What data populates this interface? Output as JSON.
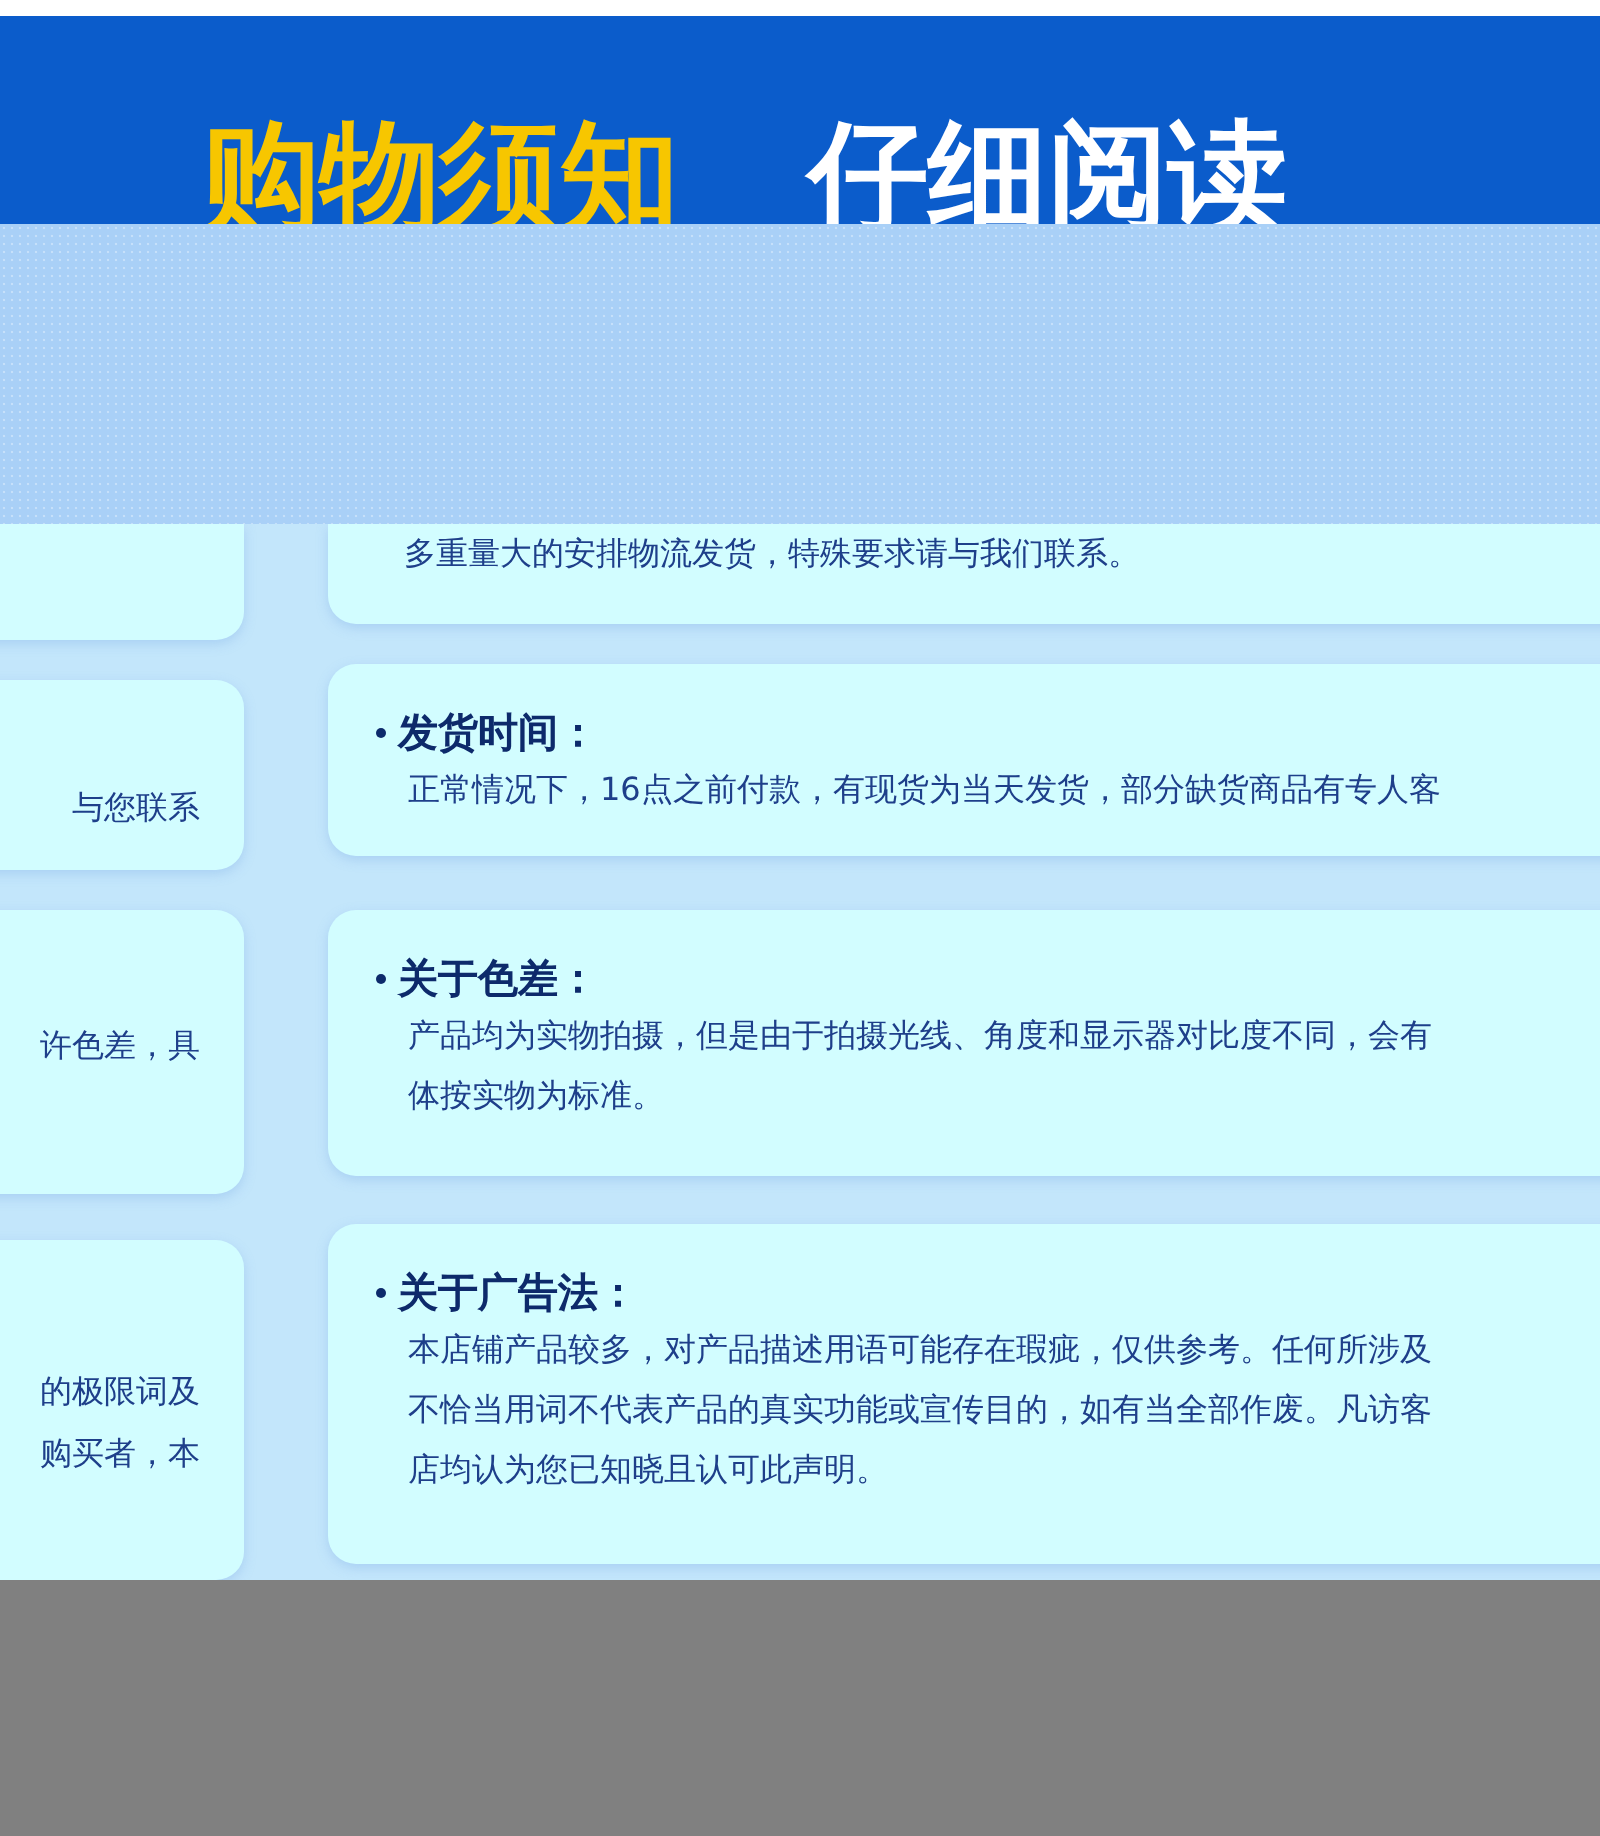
{
  "header": {
    "title_highlight": "购物须知",
    "title_rest": "仔细阅读"
  },
  "left_cards": [
    {
      "lines": [
        "与您联系"
      ]
    },
    {
      "lines": [
        "许色差，具"
      ]
    },
    {
      "lines": [
        "的极限词及",
        "购买者，本"
      ]
    }
  ],
  "right_cards": [
    {
      "lines": [
        "多重量大的安排物流发货，特殊要求请与我们联系。"
      ]
    },
    {
      "heading": "发货时间：",
      "lines": [
        "正常情况下，16点之前付款，有现货为当天发货，部分缺货商品有专人客"
      ]
    },
    {
      "heading": "关于色差：",
      "lines": [
        "产品均为实物拍摄，但是由于拍摄光线、角度和显示器对比度不同，会有",
        "体按实物为标准。"
      ]
    },
    {
      "heading": "关于广告法：",
      "lines": [
        "本店铺产品较多，对产品描述用语可能存在瑕疵，仅供参考。任何所涉及",
        "不恰当用词不代表产品的真实功能或宣传目的，如有当全部作废。凡访客",
        "店均认为您已知晓且认可此声明。"
      ]
    }
  ]
}
